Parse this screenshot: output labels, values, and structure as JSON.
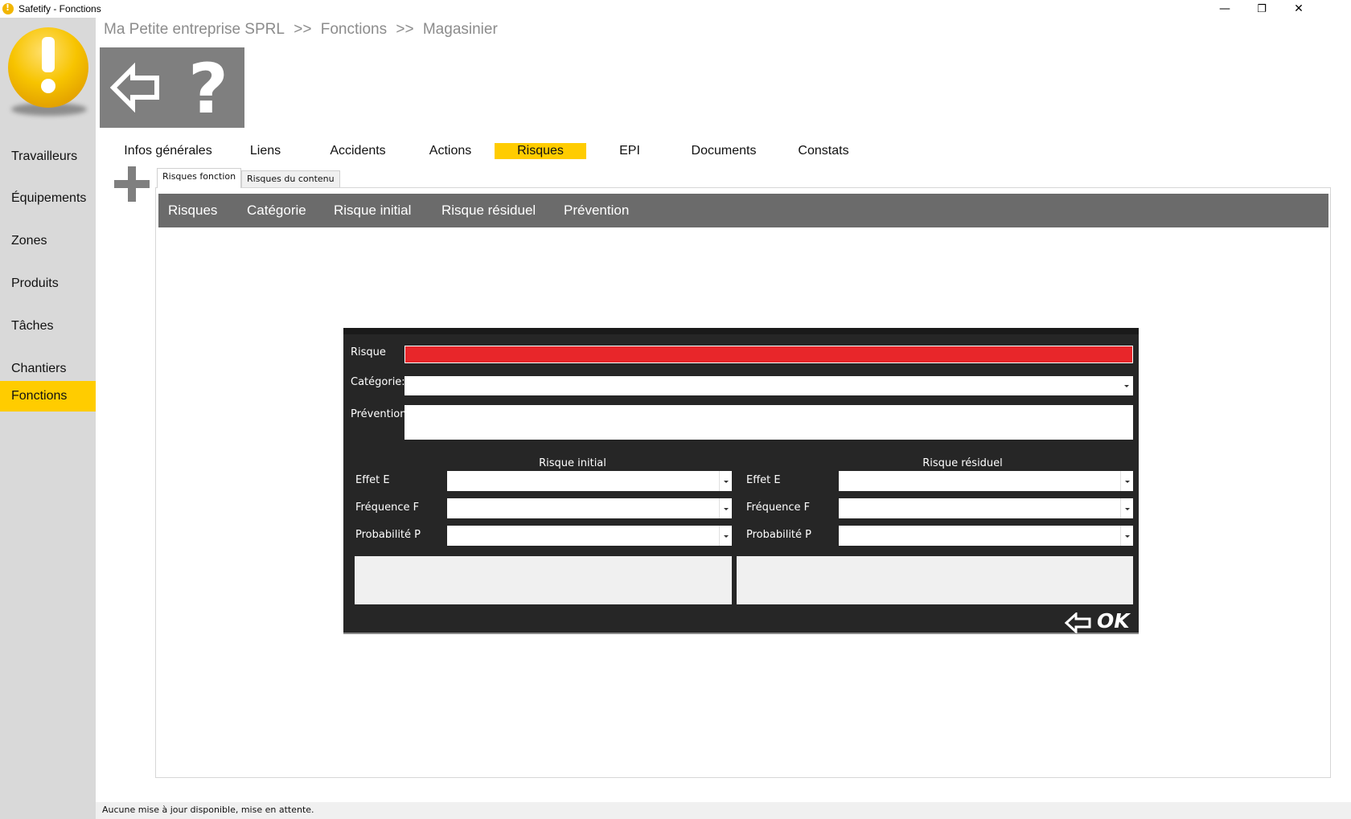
{
  "window": {
    "title": "Safetify - Fonctions",
    "minimize": "—",
    "restore": "❐",
    "close": "✕"
  },
  "sidebar": {
    "items": [
      {
        "label": "Travailleurs"
      },
      {
        "label": "Équipements"
      },
      {
        "label": "Zones"
      },
      {
        "label": "Produits"
      },
      {
        "label": "Tâches"
      },
      {
        "label": "Chantiers"
      },
      {
        "label": "Fonctions",
        "active": true
      }
    ]
  },
  "breadcrumb": {
    "company": "Ma Petite entreprise SPRL",
    "sep1": ">>",
    "section": "Fonctions",
    "sep2": ">>",
    "item": "Magasinier"
  },
  "toolbar": {
    "back_icon": "back-arrow-icon",
    "help_label": "?"
  },
  "tabs": [
    {
      "label": "Infos générales"
    },
    {
      "label": "Liens"
    },
    {
      "label": "Accidents"
    },
    {
      "label": "Actions"
    },
    {
      "label": "Risques",
      "active": true
    },
    {
      "label": "EPI"
    },
    {
      "label": "Documents"
    },
    {
      "label": "Constats"
    }
  ],
  "subtabs": {
    "active": "Risques fonction",
    "inactive": "Risques du contenu"
  },
  "grid": {
    "columns": [
      "Risques",
      "Catégorie",
      "Risque initial",
      "Risque résiduel",
      "Prévention"
    ]
  },
  "dialog": {
    "risque_label": "Risque",
    "categorie_label": "Catégorie:",
    "prevention_label": "Prévention",
    "initial_title": "Risque initial",
    "residuel_title": "Risque résiduel",
    "effet_label": "Effet E",
    "frequence_label": "Fréquence F",
    "probabilite_label": "Probabilité P",
    "ok_label": "OK"
  },
  "status": {
    "message": "Aucune mise à jour disponible, mise en attente."
  },
  "colors": {
    "accent": "#ffcc00",
    "sidebar_bg": "#d9d9d9",
    "panel_gray": "#7f7f7f",
    "grid_header": "#6b6b6b",
    "dialog_bg": "#262626",
    "required_field": "#e8262a"
  }
}
